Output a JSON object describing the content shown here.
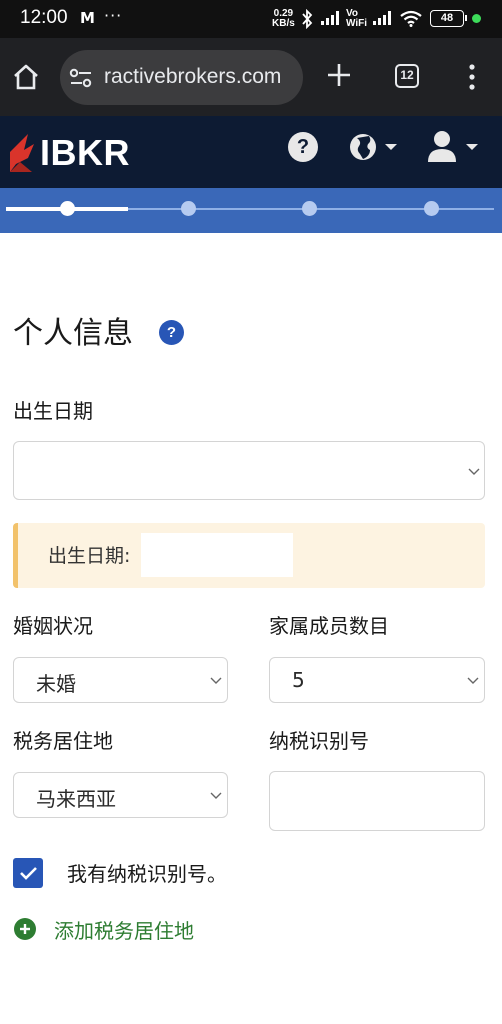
{
  "status_bar": {
    "time": "12:00",
    "mail_icon": "M",
    "more": "···",
    "speed_value": "0.29",
    "speed_unit": "KB/s",
    "vo": "Vo",
    "wifi_label": "WiFi",
    "battery": "48"
  },
  "browser": {
    "url": "ractivebrokers.com",
    "tab_count": "12"
  },
  "header": {
    "logo_text": "IBKR",
    "help": "?"
  },
  "progress": {
    "steps": 4,
    "current_step": 1
  },
  "page": {
    "title": "个人信息",
    "help": "?"
  },
  "form": {
    "dob_label": "出生日期",
    "dob_value": "",
    "dob_notice": "出生日期:",
    "marital_label": "婚姻状况",
    "marital_value": "未婚",
    "dependents_label": "家属成员数目",
    "dependents_value": "5",
    "tax_residence_label": "税务居住地",
    "tax_residence_value": "马来西亚",
    "tin_label": "纳税识别号",
    "tin_value": "",
    "has_tin_label": "我有纳税识别号。",
    "has_tin_checked": true,
    "add_residence_label": "添加税务居住地"
  },
  "colors": {
    "header_bg": "#0d1b33",
    "progress_bg": "#3a68b8",
    "accent_blue": "#2856b6",
    "add_green": "#2e7d32",
    "notice_bg": "#fdf3e1",
    "notice_border": "#f2c26b",
    "logo_red": "#d9342b"
  }
}
